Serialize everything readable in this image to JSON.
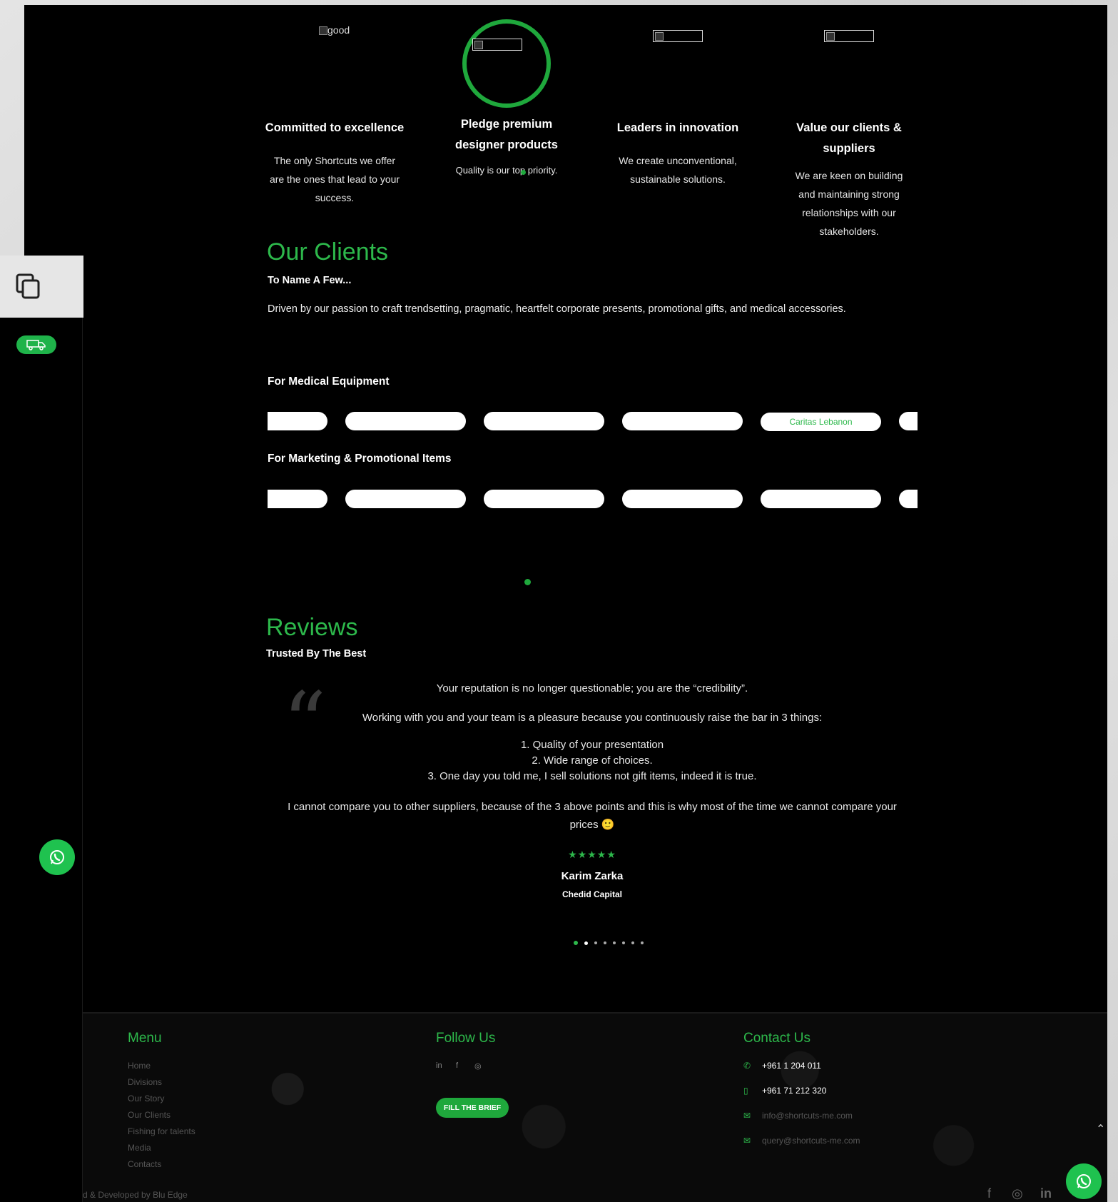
{
  "features": [
    {
      "alt": "good",
      "title_lines": [
        "Committed to excellence"
      ],
      "desc_lines": [
        "The only Shortcuts we offer",
        "are the ones that lead to your",
        "success."
      ]
    },
    {
      "alt": "",
      "title_lines": [
        "Pledge premium",
        "designer products"
      ],
      "desc_lines": [
        "Quality is our top priority."
      ]
    },
    {
      "alt": "",
      "title_lines": [
        "Leaders in innovation"
      ],
      "desc_lines": [
        "We create unconventional,",
        "sustainable solutions."
      ]
    },
    {
      "alt": "",
      "title_lines": [
        "Value our clients &",
        "suppliers"
      ],
      "desc_lines": [
        "We are keen on building",
        "and maintaining strong",
        "relationships with our",
        "stakeholders."
      ]
    }
  ],
  "clients": {
    "title": "Our Clients",
    "subtitle": "To Name A Few...",
    "description": "Driven by our passion to craft trendsetting, pragmatic, heartfelt corporate presents, promotional gifts, and medical accessories.",
    "medical_heading": "For Medical Equipment",
    "medical_logos": [
      "",
      "",
      "",
      "",
      "Caritas Lebanon",
      ""
    ],
    "marketing_heading": "For Marketing & Promotional Items",
    "marketing_logos": [
      "",
      "",
      "",
      "",
      "",
      ""
    ]
  },
  "reviews": {
    "title": "Reviews",
    "subtitle": "Trusted By The Best",
    "lines": [
      "Your reputation is no longer questionable; you are the “credibility”.",
      "Working with you and your team is a pleasure because you continuously raise the bar in 3 things:",
      "1. Quality of your presentation",
      "2. Wide range of choices.",
      "3. One day you told me, I sell solutions not gift items, indeed it is true.",
      "I cannot compare you to other suppliers, because of the 3 above points and this is why most of the time we cannot compare your",
      "prices 🙂"
    ],
    "rating": 5,
    "stars": "★★★★★",
    "name": "Karim Zarka",
    "company": "Chedid Capital",
    "pages": 8,
    "active_page": 1
  },
  "footer": {
    "menu_title": "Menu",
    "menu_items": [
      "Home",
      "Divisions",
      "Our Story",
      "Our Clients",
      "Fishing for talents",
      "Media",
      "Contacts"
    ],
    "follow_title": "Follow Us",
    "social": [
      "in",
      "f",
      "◎"
    ],
    "brief_button": "FILL THE BRIEF",
    "contact_title": "Contact Us",
    "contacts": [
      {
        "icon": "phone-icon",
        "glyph": "✆",
        "text": "+961 1 204 011",
        "color": "#ffffff"
      },
      {
        "icon": "mobile-icon",
        "glyph": "▯",
        "text": "+961 71 212 320",
        "color": "#ffffff"
      },
      {
        "icon": "mail-icon",
        "glyph": "✉",
        "text": "info@shortcuts-me.com",
        "color": "#555555"
      },
      {
        "icon": "mail-icon",
        "glyph": "✉",
        "text": "query@shortcuts-me.com",
        "color": "#555555"
      }
    ],
    "copyright": "d & Developed by Blu Edge",
    "bottom_social": [
      "f",
      "◎",
      "in"
    ]
  },
  "colors": {
    "accent": "#2db84b",
    "background": "#000000"
  }
}
